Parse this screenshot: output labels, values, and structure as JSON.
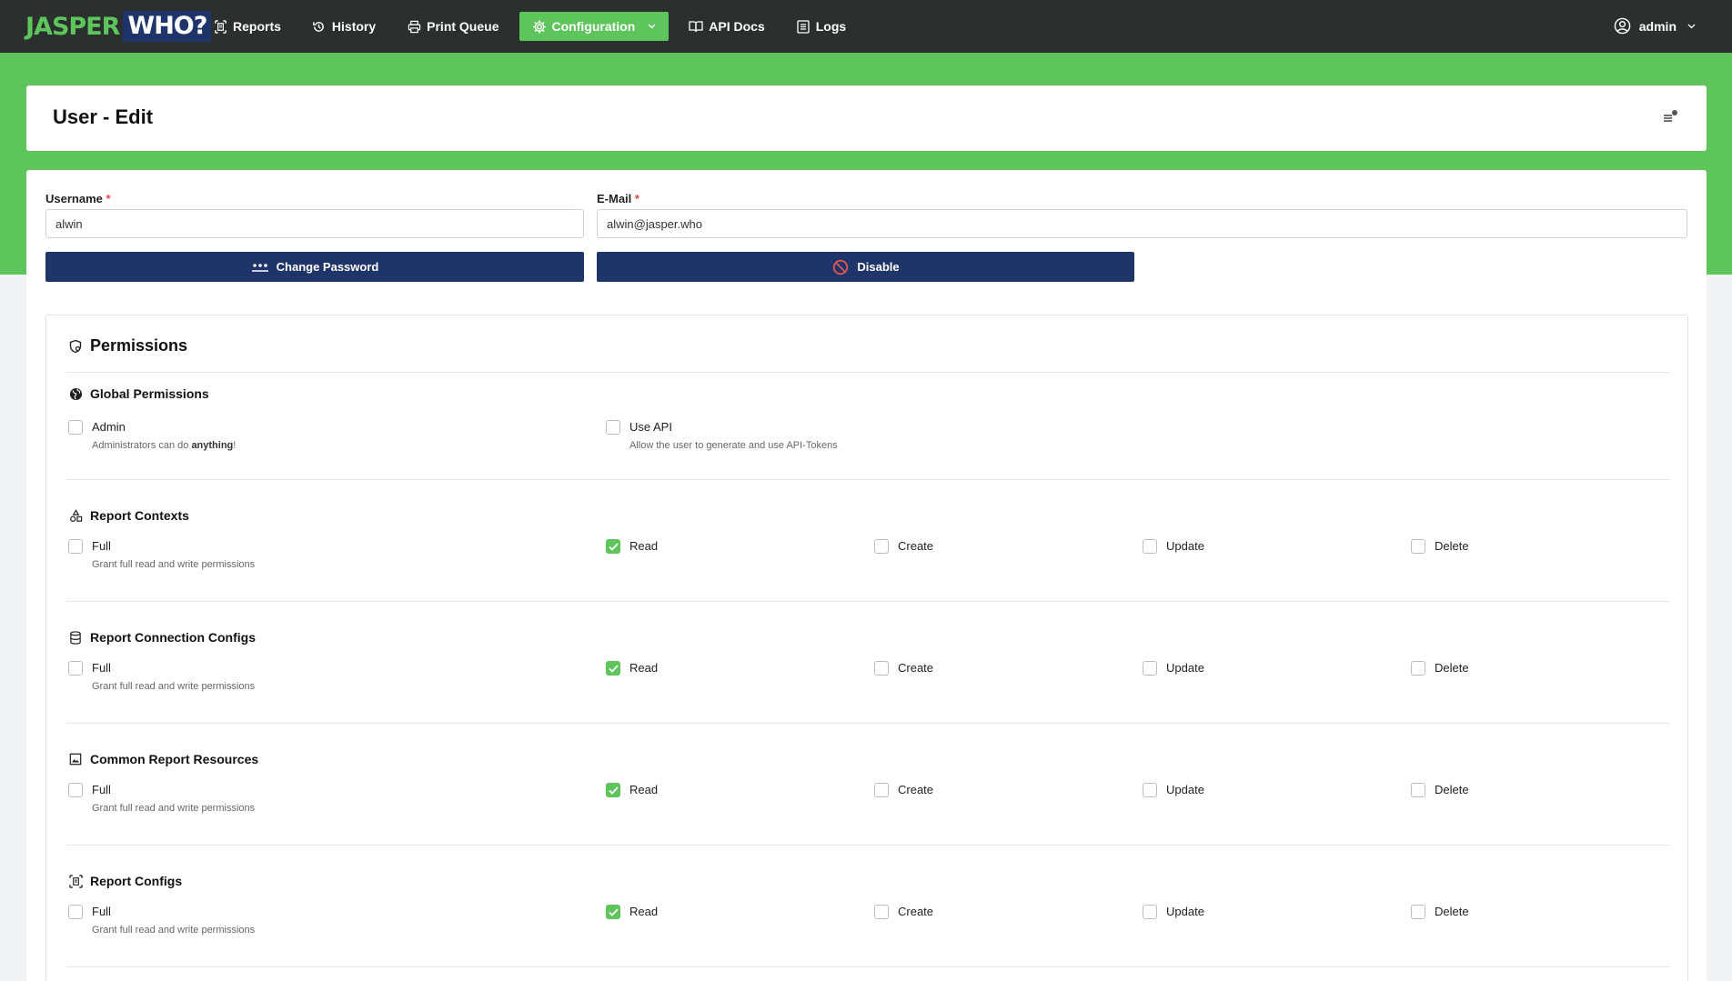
{
  "logo": {
    "part1": "JASPER",
    "part2": "WHO?"
  },
  "nav": {
    "reports": "Reports",
    "history": "History",
    "print_queue": "Print Queue",
    "configuration": "Configuration",
    "api_docs": "API Docs",
    "logs": "Logs"
  },
  "user": {
    "name": "admin"
  },
  "page": {
    "title": "User - Edit"
  },
  "form": {
    "username_label": "Username",
    "username_value": "alwin",
    "email_label": "E-Mail",
    "email_value": "alwin@jasper.who",
    "required_mark": "*",
    "change_password_label": "Change Password",
    "disable_label": "Disable"
  },
  "permissions": {
    "title": "Permissions",
    "global": {
      "title": "Global Permissions",
      "admin_label": "Admin",
      "admin_desc_pre": "Administrators can do ",
      "admin_desc_bold": "anything",
      "admin_desc_post": "!",
      "admin_checked": false,
      "api_label": "Use API",
      "api_desc": "Allow the user to generate and use API-Tokens",
      "api_checked": false
    },
    "labels": {
      "full": "Full",
      "full_desc": "Grant full read and write permissions",
      "read": "Read",
      "create": "Create",
      "update": "Update",
      "delete": "Delete"
    },
    "sections": [
      {
        "title": "Report Contexts",
        "icon": "shapes-icon",
        "full": false,
        "read": true,
        "create": false,
        "update": false,
        "delete": false
      },
      {
        "title": "Report Connection Configs",
        "icon": "database-icon",
        "full": false,
        "read": true,
        "create": false,
        "update": false,
        "delete": false
      },
      {
        "title": "Common Report Resources",
        "icon": "image-icon",
        "full": false,
        "read": true,
        "create": false,
        "update": false,
        "delete": false
      },
      {
        "title": "Report Configs",
        "icon": "report-config-icon",
        "full": false,
        "read": true,
        "create": false,
        "update": false,
        "delete": false
      }
    ]
  },
  "colors": {
    "accent": "#5ec55c",
    "navbar": "#2b2f2e",
    "primary": "#1f3569"
  }
}
